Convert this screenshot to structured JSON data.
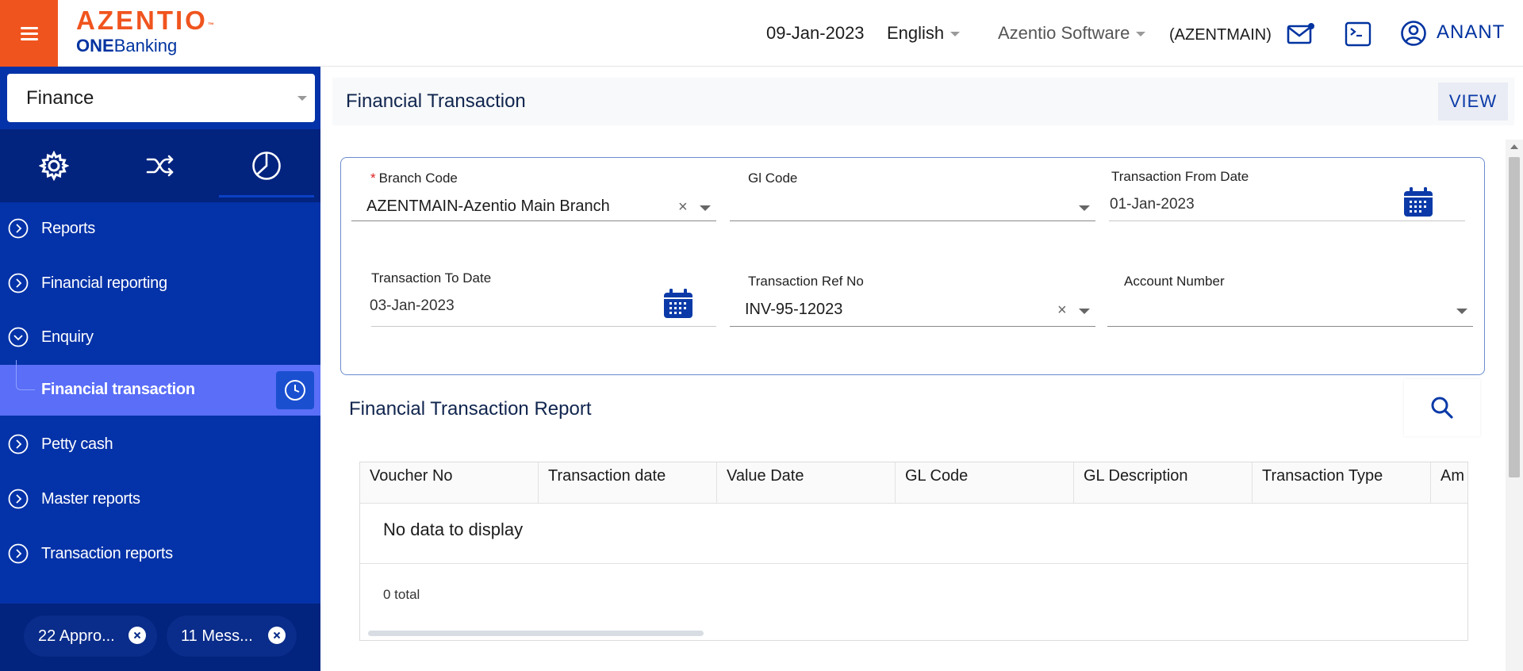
{
  "header": {
    "brand": "AZENTIO",
    "brand_tm": "™",
    "product_bold": "ONE",
    "product_rest": "Banking",
    "date": "09-Jan-2023",
    "language": "English",
    "company": "Azentio Software",
    "branch": "(AZENTMAIN)",
    "user": "ANANT",
    "accent": "#f0541e"
  },
  "sidebar": {
    "module": "Finance",
    "tabs": [
      "gear-icon",
      "shuffle-icon",
      "pie-chart-icon"
    ],
    "items": [
      {
        "label": "Reports"
      },
      {
        "label": "Financial reporting"
      },
      {
        "label": "Enquiry"
      },
      {
        "label": "Petty cash"
      },
      {
        "label": "Master reports"
      },
      {
        "label": "Transaction reports"
      }
    ],
    "active_sub": "Financial transaction",
    "chips": [
      {
        "label": "22 Appro..."
      },
      {
        "label": "11 Mess..."
      }
    ],
    "bg": "#0432a8"
  },
  "main": {
    "page_title": "Financial Transaction",
    "view_label": "VIEW",
    "fields": {
      "branch_code": {
        "label": "Branch Code",
        "required": "*",
        "value": "AZENTMAIN-Azentio Main Branch"
      },
      "gl_code": {
        "label": "Gl Code",
        "value": ""
      },
      "from_date": {
        "label": "Transaction From Date",
        "value": "01-Jan-2023"
      },
      "to_date": {
        "label": "Transaction To Date",
        "value": "03-Jan-2023"
      },
      "ref_no": {
        "label": "Transaction Ref No",
        "value": "INV-95-12023"
      },
      "account_number": {
        "label": "Account Number",
        "value": ""
      }
    },
    "report": {
      "title": "Financial Transaction Report",
      "columns": [
        "Voucher No",
        "Transaction date",
        "Value Date",
        "GL Code",
        "GL Description",
        "Transaction Type",
        "Am"
      ],
      "empty_text": "No data to display",
      "total_text": "0 total"
    }
  }
}
